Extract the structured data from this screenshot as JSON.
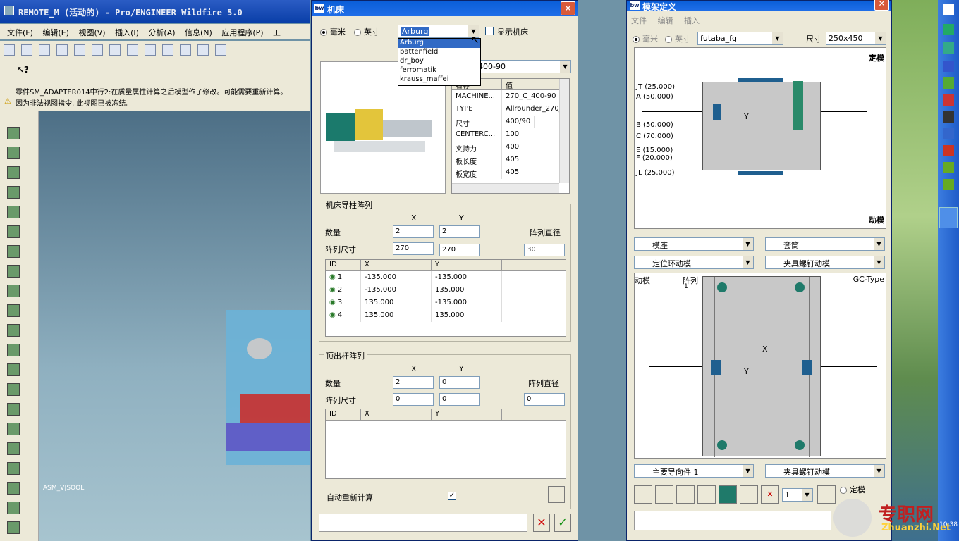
{
  "proe": {
    "title": "REMOTE_M (活动的) - Pro/ENGINEER Wildfire 5.0",
    "menu": [
      "文件(F)",
      "编辑(E)",
      "视图(V)",
      "插入(I)",
      "分析(A)",
      "信息(N)",
      "应用程序(P)",
      "工"
    ],
    "messages": [
      "零件SM_ADAPTER014中行2:在质量属性计算之后模型作了修改。可能需要重新计算。",
      "因为非法视图指令, 此视图已被冻结。"
    ],
    "canvas_label": "ASM_V|SOOL"
  },
  "machine": {
    "title": "机床",
    "unit_mm": "毫米",
    "unit_inch": "英寸",
    "maker_selected": "Arburg",
    "show_machine": "显示机床",
    "maker_options": [
      "Arburg",
      "battenfield",
      "dr_boy",
      "ferromatik",
      "krauss_maffei"
    ],
    "model_value": "400-90",
    "props_headers": [
      "名称",
      "值"
    ],
    "props": [
      [
        "MACHINE...",
        "270_C_400-90"
      ],
      [
        "TYPE",
        "Allrounder_270_"
      ],
      [
        "尺寸",
        "400/90"
      ],
      [
        "CENTERC...",
        "100"
      ],
      [
        "夹持力",
        "400"
      ],
      [
        "板长度",
        "405"
      ],
      [
        "板宽度",
        "405"
      ]
    ],
    "tiebar": {
      "title": "机床导柱阵列",
      "x": "X",
      "y": "Y",
      "qty_label": "数量",
      "qty_x": "2",
      "qty_y": "2",
      "size_label": "阵列尺寸",
      "size_x": "270",
      "size_y": "270",
      "dia_label": "阵列直径",
      "dia": "30",
      "headers": [
        "ID",
        "X",
        "Y"
      ],
      "rows": [
        [
          "1",
          "-135.000",
          "-135.000"
        ],
        [
          "2",
          "-135.000",
          "135.000"
        ],
        [
          "3",
          "135.000",
          "-135.000"
        ],
        [
          "4",
          "135.000",
          "135.000"
        ]
      ]
    },
    "ejector": {
      "title": "顶出杆阵列",
      "x": "X",
      "y": "Y",
      "qty_label": "数量",
      "qty_x": "2",
      "qty_y": "0",
      "size_label": "阵列尺寸",
      "size_x": "0",
      "size_y": "0",
      "dia_label": "阵列直径",
      "dia": "0",
      "headers": [
        "ID",
        "X",
        "Y"
      ]
    },
    "auto_recalc": "自动重新计算"
  },
  "mold": {
    "title": "模架定义",
    "menu": [
      "文件",
      "编辑",
      "插入"
    ],
    "unit_mm": "毫米",
    "unit_inch": "英寸",
    "vendor": "futaba_fg",
    "size_label": "尺寸",
    "size_value": "250x450",
    "top_label": "定模",
    "bottom_label": "动模",
    "plate_labels": [
      "JT (25.000)",
      "A (50.000)",
      "B (50.000)",
      "C (70.000)",
      "E (15.000)",
      "F (20.000)",
      "JL (25.000)"
    ],
    "y_mark": "Y",
    "combos": [
      "模座",
      "套筒",
      "定位环动模",
      "夹具螺钉动模"
    ],
    "plan_left": "动模",
    "plan_array": "阵列",
    "plan_array_n": "1",
    "plan_type": "GC-Type",
    "x_mark": "X",
    "bottom_combos": [
      "主要导向件 1",
      "夹具螺钉动模"
    ],
    "count": "1",
    "radio_top": "定模"
  },
  "watermark": {
    "cn": "专职网",
    "url": "Zhuanzhi.Net"
  },
  "clock": "10:38"
}
